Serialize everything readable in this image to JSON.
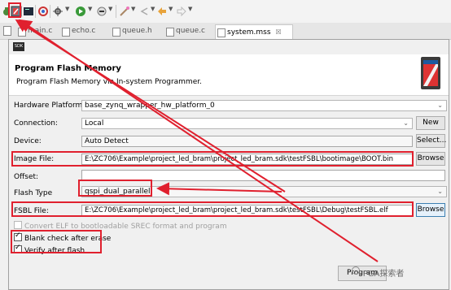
{
  "toolbar": {
    "icons": [
      "debug-icon",
      "program-flash-icon",
      "terminal-icon",
      "xilinx-tools-icon",
      "settings-icon",
      "run-icon",
      "external-tools-icon",
      "build-icon",
      "back-icon",
      "forward-icon"
    ]
  },
  "tabs": [
    {
      "label": "main.c"
    },
    {
      "label": "echo.c"
    },
    {
      "label": "queue.h"
    },
    {
      "label": "queue.c"
    },
    {
      "label": "system.mss",
      "close": "☒"
    }
  ],
  "dialog": {
    "badge": "SDK",
    "title": "Program Flash Memory",
    "subtitle": "Program Flash Memory via In-system Programmer.",
    "hardware_platform": {
      "label": "Hardware Platform:",
      "value": "base_zynq_wrapper_hw_platform_0"
    },
    "connection": {
      "label": "Connection:",
      "value": "Local",
      "button": "New"
    },
    "device": {
      "label": "Device:",
      "value": "Auto Detect",
      "button": "Select..."
    },
    "image_file": {
      "label": "Image File:",
      "value": "E:\\ZC706\\Example\\project_led_bram\\project_led_bram.sdk\\testFSBL\\bootimage\\BOOT.bin",
      "button": "Browse"
    },
    "offset": {
      "label": "Offset:",
      "value": ""
    },
    "flash_type": {
      "label": "Flash Type",
      "value": "qspi_dual_parallel"
    },
    "fsbl_file": {
      "label": "FSBL File:",
      "value": "E:\\ZC706\\Example\\project_led_bram\\project_led_bram.sdk\\testFSBL\\Debug\\testFSBL.elf",
      "button": "Browse"
    },
    "convert_elf": {
      "label": "Convert ELF to bootloadable SREC format and program",
      "checked": false,
      "enabled": false
    },
    "blank_check": {
      "label": "Blank check after erase",
      "checked": true
    },
    "verify": {
      "label": "Verify after flash",
      "checked": true
    },
    "program_button": "Program"
  },
  "watermark": "FPGA探索者",
  "colors": {
    "highlight": "#e0202e",
    "accent": "#3c7fb1"
  }
}
